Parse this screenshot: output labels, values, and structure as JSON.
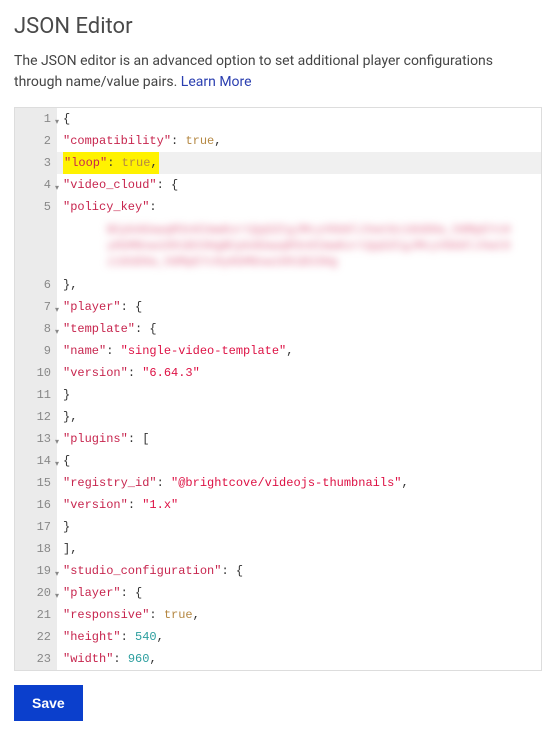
{
  "title": "JSON Editor",
  "description_pre": "The JSON editor is an advanced option to set additional player configurations through name/value pairs. ",
  "learn_more": "Learn More",
  "save_label": "Save",
  "lines": [
    {
      "n": 1,
      "fold": true,
      "indent": 0,
      "tokens": [
        {
          "t": "{",
          "c": "p"
        }
      ]
    },
    {
      "n": 2,
      "indent": 1,
      "tokens": [
        {
          "t": "\"compatibility\"",
          "c": "k"
        },
        {
          "t": ": ",
          "c": "p"
        },
        {
          "t": "true",
          "c": "b"
        },
        {
          "t": ",",
          "c": "p"
        }
      ]
    },
    {
      "n": 3,
      "current": true,
      "indent": 1,
      "hl": true,
      "tokens": [
        {
          "t": "\"loop\"",
          "c": "k"
        },
        {
          "t": ": ",
          "c": "p"
        },
        {
          "t": "true",
          "c": "b"
        },
        {
          "t": ",",
          "c": "p"
        }
      ]
    },
    {
      "n": 4,
      "fold": true,
      "indent": 1,
      "tokens": [
        {
          "t": "\"video_cloud\"",
          "c": "k"
        },
        {
          "t": ": {",
          "c": "p"
        }
      ]
    },
    {
      "n": 5,
      "indent": 2,
      "tokens": [
        {
          "t": "\"policy_key\"",
          "c": "k"
        },
        {
          "t": ":",
          "c": "p"
        }
      ],
      "redacted_after": true
    },
    {
      "n": 6,
      "indent": 1,
      "tokens": [
        {
          "t": "},",
          "c": "p"
        }
      ]
    },
    {
      "n": 7,
      "fold": true,
      "indent": 1,
      "tokens": [
        {
          "t": "\"player\"",
          "c": "k"
        },
        {
          "t": ": {",
          "c": "p"
        }
      ]
    },
    {
      "n": 8,
      "fold": true,
      "indent": 2,
      "tokens": [
        {
          "t": "\"template\"",
          "c": "k"
        },
        {
          "t": ": {",
          "c": "p"
        }
      ]
    },
    {
      "n": 9,
      "indent": 3,
      "tokens": [
        {
          "t": "\"name\"",
          "c": "k"
        },
        {
          "t": ": ",
          "c": "p"
        },
        {
          "t": "\"single-video-template\"",
          "c": "s"
        },
        {
          "t": ",",
          "c": "p"
        }
      ]
    },
    {
      "n": 10,
      "indent": 3,
      "tokens": [
        {
          "t": "\"version\"",
          "c": "k"
        },
        {
          "t": ": ",
          "c": "p"
        },
        {
          "t": "\"6.64.3\"",
          "c": "s"
        }
      ]
    },
    {
      "n": 11,
      "indent": 2,
      "tokens": [
        {
          "t": "}",
          "c": "p"
        }
      ]
    },
    {
      "n": 12,
      "indent": 1,
      "tokens": [
        {
          "t": "},",
          "c": "p"
        }
      ]
    },
    {
      "n": 13,
      "fold": true,
      "indent": 1,
      "tokens": [
        {
          "t": "\"plugins\"",
          "c": "k"
        },
        {
          "t": ": [",
          "c": "p"
        }
      ]
    },
    {
      "n": 14,
      "fold": true,
      "indent": 2,
      "tokens": [
        {
          "t": "{",
          "c": "p"
        }
      ]
    },
    {
      "n": 15,
      "indent": 3,
      "tokens": [
        {
          "t": "\"registry_id\"",
          "c": "k"
        },
        {
          "t": ": ",
          "c": "p"
        },
        {
          "t": "\"@brightcove/videojs-thumbnails\"",
          "c": "s"
        },
        {
          "t": ",",
          "c": "p"
        }
      ]
    },
    {
      "n": 16,
      "indent": 3,
      "tokens": [
        {
          "t": "\"version\"",
          "c": "k"
        },
        {
          "t": ": ",
          "c": "p"
        },
        {
          "t": "\"1.x\"",
          "c": "s"
        }
      ]
    },
    {
      "n": 17,
      "indent": 2,
      "tokens": [
        {
          "t": "}",
          "c": "p"
        }
      ]
    },
    {
      "n": 18,
      "indent": 1,
      "tokens": [
        {
          "t": "],",
          "c": "p"
        }
      ]
    },
    {
      "n": 19,
      "fold": true,
      "indent": 1,
      "tokens": [
        {
          "t": "\"studio_configuration\"",
          "c": "k"
        },
        {
          "t": ": {",
          "c": "p"
        }
      ]
    },
    {
      "n": 20,
      "fold": true,
      "indent": 2,
      "tokens": [
        {
          "t": "\"player\"",
          "c": "k"
        },
        {
          "t": ": {",
          "c": "p"
        }
      ]
    },
    {
      "n": 21,
      "indent": 3,
      "tokens": [
        {
          "t": "\"responsive\"",
          "c": "k"
        },
        {
          "t": ": ",
          "c": "p"
        },
        {
          "t": "true",
          "c": "b"
        },
        {
          "t": ",",
          "c": "p"
        }
      ]
    },
    {
      "n": 22,
      "indent": 3,
      "tokens": [
        {
          "t": "\"height\"",
          "c": "k"
        },
        {
          "t": ": ",
          "c": "p"
        },
        {
          "t": "540",
          "c": "n"
        },
        {
          "t": ",",
          "c": "p"
        }
      ]
    },
    {
      "n": 23,
      "indent": 3,
      "tokens": [
        {
          "t": "\"width\"",
          "c": "k"
        },
        {
          "t": ": ",
          "c": "p"
        },
        {
          "t": "960",
          "c": "n"
        },
        {
          "t": ",",
          "c": "p"
        }
      ]
    }
  ],
  "redacted_placeholder": "BCpkADawqM3n0ImwKortQqSZCgJMcyVbb8lJVwt0z16UD0a_h8MpEYcHyKbM8ow1091B33Hg"
}
